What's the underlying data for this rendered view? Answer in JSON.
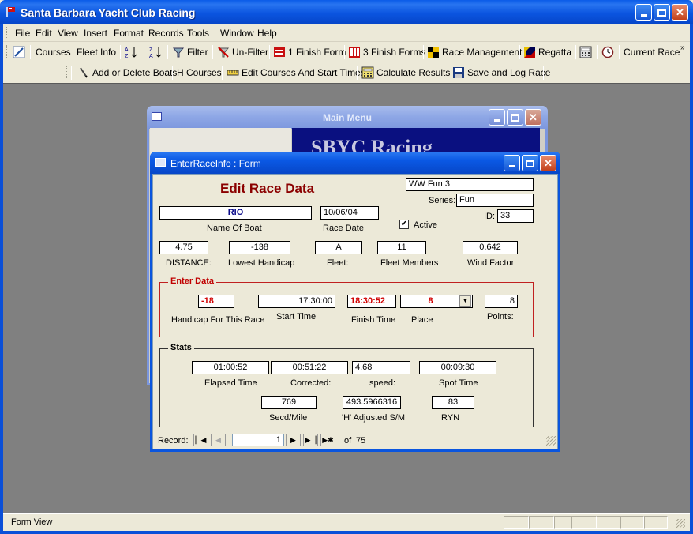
{
  "app": {
    "title": "Santa Barbara Yacht Club Racing"
  },
  "menu": [
    "File",
    "Edit",
    "View",
    "Insert",
    "Format",
    "Records",
    "Tools",
    "Window",
    "Help"
  ],
  "toolbar1": {
    "courses": "Courses",
    "fleet_info": "Fleet Info",
    "filter": "Filter",
    "unfilter": "Un-Filter",
    "finish_form_1": "1 Finish Form",
    "finish_forms_3": "3 Finish Forms",
    "race_management": "Race Management",
    "regatta": "Regatta",
    "current_race": "Current Race"
  },
  "toolbar2": {
    "add_delete_boats": "Add or Delete Boats",
    "h_courses": "H Courses",
    "edit_courses": "Edit Courses And Start Times",
    "calculate_results": "Calculate Results",
    "save_log": "Save and Log Race"
  },
  "main_menu": {
    "title": "Main Menu",
    "banner": "SBYC Racing"
  },
  "form": {
    "title": "EnterRaceInfo : Form",
    "heading": "Edit Race Data",
    "race_name": "WW Fun 3",
    "series_label": "Series:",
    "series": "Fun",
    "id_label": "ID:",
    "id": "33",
    "boat_name": "RIO",
    "boat_name_label": "Name Of Boat",
    "race_date": "10/06/04",
    "race_date_label": "Race Date",
    "active_label": "Active",
    "active_checked": true,
    "distance": "4.75",
    "distance_label": "DISTANCE:",
    "lowest_handicap": "-138",
    "lowest_handicap_label": "Lowest Handicap",
    "fleet": "A",
    "fleet_label": "Fleet:",
    "fleet_members": "11",
    "fleet_members_label": "Fleet Members",
    "wind_factor": "0.642",
    "wind_factor_label": "Wind Factor",
    "enter_data": {
      "title": "Enter Data",
      "handicap": "-18",
      "handicap_label": "Handicap For This Race",
      "start_time": "17:30:00",
      "start_time_label": "Start Time",
      "finish_time": "18:30:52",
      "finish_time_label": "Finish Time",
      "place": "8",
      "place_label": "Place",
      "points": "8",
      "points_label": "Points:"
    },
    "stats": {
      "title": "Stats",
      "elapsed": "01:00:52",
      "elapsed_label": "Elapsed Time",
      "corrected": "00:51:22",
      "corrected_label": "Corrected:",
      "speed": "4.68",
      "speed_label": "speed:",
      "spot_time": "00:09:30",
      "spot_time_label": "Spot Time",
      "secd_mile": "769",
      "secd_mile_label": "Secd/Mile",
      "h_adjusted": "493.5966316",
      "h_adjusted_label": "'H' Adjusted S/M",
      "ryn": "83",
      "ryn_label": "RYN"
    },
    "nav": {
      "record_label": "Record:",
      "current": "1",
      "of_label": "of",
      "total": "75"
    }
  },
  "status": {
    "text": "Form View"
  }
}
